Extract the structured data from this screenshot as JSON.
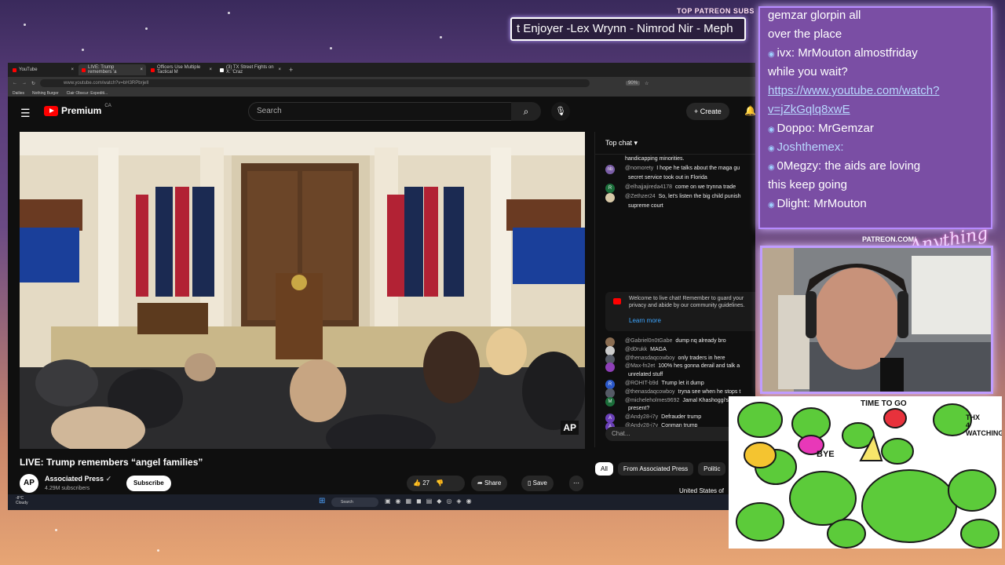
{
  "overlay": {
    "patreon_title": "TOP PATREON SUBS",
    "ticker_text": "t Enjoyer -Lex Wrynn - Nimrod Nir - Meph",
    "patreon_tag": "PATREON.COM/",
    "brand_script": "Anything Else"
  },
  "browser": {
    "tabs": [
      {
        "label": "YouTube"
      },
      {
        "label": "LIVE: Trump remembers 'a"
      },
      {
        "label": "Officers Use Multiple Tactical M"
      },
      {
        "label": "(3) TX Street Fights on X: 'Craz"
      }
    ],
    "new_tab": "+",
    "url": "www.youtube.com/watch?v=bH3RPbrjeII",
    "zoom": "90%",
    "bookmarks": [
      "Dailies",
      "Nothing Burger",
      "Clair Obscur: Expediti..."
    ]
  },
  "youtube": {
    "logo_text": "Premium",
    "logo_region": "CA",
    "search_placeholder": "Search",
    "create_label": "Create",
    "video_title": "LIVE: Trump remembers “angel families”",
    "watermark": "AP",
    "channel": {
      "avatar": "AP",
      "name": "Associated Press",
      "subs": "4.29M subscribers",
      "subscribe_label": "Subscribe"
    },
    "likes": "27",
    "share_label": "Share",
    "save_label": "Save",
    "chat": {
      "header": "Top chat",
      "partial_line": "handicapping minorities.",
      "messages": [
        {
          "avatar": "nb",
          "avatar_color": "#7b5ea7",
          "user": "@nomorety",
          "text": "I hope he talks about the maga gu"
        },
        {
          "avatar": "",
          "avatar_color": "#000000",
          "user": "",
          "text": "secret service took out in Florida"
        },
        {
          "avatar": "R",
          "avatar_color": "#1b6e3a",
          "user": "@elhajjajireda4178",
          "text": "come on we trynna trade"
        },
        {
          "avatar": "",
          "avatar_color": "#d8c9a8",
          "user": "@Zethzer24",
          "text": "So, let's listen the big child punish"
        },
        {
          "avatar": "",
          "avatar_color": "#000000",
          "user": "",
          "text": "supreme court"
        }
      ],
      "welcome_text": "Welcome to live chat! Remember to guard your privacy and abide by our community guidelines.",
      "learn_more": "Learn more",
      "messages2": [
        {
          "avatar": "",
          "avatar_color": "#8a6d52",
          "user": "@Gabriel0n0tGabe",
          "text": "dump nq already bro"
        },
        {
          "avatar": "",
          "avatar_color": "#cccccc",
          "user": "@d0rukk",
          "text": "MAGA"
        },
        {
          "avatar": "",
          "avatar_color": "#555a66",
          "user": "@thenasdaqcowboy",
          "text": "only traders in here"
        },
        {
          "avatar": "",
          "avatar_color": "#8e3fb8",
          "user": "@Max-fn2et",
          "text": "100% hes gonna derail and talk a"
        },
        {
          "avatar": "",
          "avatar_color": "#000000",
          "user": "",
          "text": "unrelated stuff"
        },
        {
          "avatar": "R",
          "avatar_color": "#2a58c9",
          "user": "@ROHIT-b9d",
          "text": "Trump let it dump"
        },
        {
          "avatar": "",
          "avatar_color": "#555a66",
          "user": "@thenasdaqcowboy",
          "text": "tryna see when he stops t"
        },
        {
          "avatar": "M",
          "avatar_color": "#1b6e3a",
          "user": "@micheleholmes9692",
          "text": "Jamal Khashoggi's farr"
        },
        {
          "avatar": "",
          "avatar_color": "#000000",
          "user": "",
          "text": "present?"
        },
        {
          "avatar": "A",
          "avatar_color": "#6a3fb8",
          "user": "@Andy28-i7y",
          "text": "Defrauder trump"
        },
        {
          "avatar": "A",
          "avatar_color": "#6a3fb8",
          "user": "@Andy28-i7y",
          "text": "Conman trump"
        }
      ],
      "input_placeholder": "Chat..."
    },
    "chips": [
      {
        "label": "All",
        "selected": true
      },
      {
        "label": "From Associated Press",
        "selected": false
      },
      {
        "label": "Politic",
        "selected": false
      }
    ],
    "related_partial": "United States of"
  },
  "taskbar": {
    "weather_temp": "-8°C",
    "weather_desc": "Cloudy",
    "search_label": "Search"
  },
  "twitch_chat": [
    {
      "user": "",
      "text": "gemzar glorpin all"
    },
    {
      "user": "",
      "text": "over the place"
    },
    {
      "user": "ivx:",
      "text": "MrMouton almostfriday"
    },
    {
      "user": "",
      "text": "while you wait?"
    },
    {
      "user": "",
      "text": "https://www.youtube.com/watch?",
      "link": true
    },
    {
      "user": "",
      "text": "v=jZkGqlq8xwE",
      "link": true
    },
    {
      "user": "Doppo:",
      "text": "MrGemzar"
    },
    {
      "user": "Joshthemex:",
      "text": ""
    },
    {
      "user": "0Megzy:",
      "text": "the aids are loving"
    },
    {
      "user": "",
      "text": "this keep going"
    },
    {
      "user": "Dlight:",
      "text": "MrMouton"
    }
  ],
  "drawing_words": [
    "TIME TO GO",
    "BYE",
    "THX 4 WATCHING"
  ]
}
